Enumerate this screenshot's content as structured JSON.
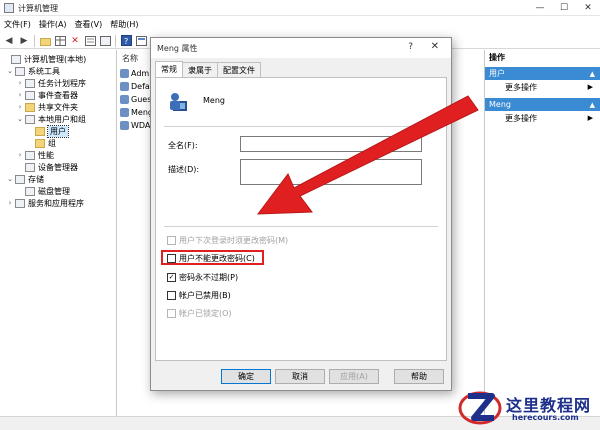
{
  "window": {
    "title": "计算机管理"
  },
  "window_controls": {
    "minimize": "—",
    "maximize": "☐",
    "close": "✕"
  },
  "menu": [
    "文件(F)",
    "操作(A)",
    "查看(V)",
    "帮助(H)"
  ],
  "tree": {
    "root": "计算机管理(本地)",
    "items": [
      {
        "label": "系统工具"
      },
      {
        "label": "任务计划程序"
      },
      {
        "label": "事件查看器"
      },
      {
        "label": "共享文件夹"
      },
      {
        "label": "本地用户和组"
      },
      {
        "label": "用户"
      },
      {
        "label": "组"
      },
      {
        "label": "性能"
      },
      {
        "label": "设备管理器"
      },
      {
        "label": "存储"
      },
      {
        "label": "磁盘管理"
      },
      {
        "label": "服务和应用程序"
      }
    ]
  },
  "list": {
    "header": "名称",
    "rows": [
      "Admi",
      "Defa",
      "Gues",
      "Meng",
      "WDA"
    ]
  },
  "actions": {
    "title": "操作",
    "sections": [
      {
        "label": "用户",
        "more": "更多操作"
      },
      {
        "label": "Meng",
        "more": "更多操作"
      }
    ]
  },
  "dialog": {
    "title": "Meng 属性",
    "help": "?",
    "close": "✕",
    "tabs": [
      "常规",
      "隶属于",
      "配置文件"
    ],
    "user_name": "Meng",
    "fullname_label": "全名(F):",
    "fullname_value": "",
    "desc_label": "描述(D):",
    "desc_value": "",
    "checkboxes": [
      {
        "label": "用户下次登录时须更改密码(M)",
        "checked": false,
        "disabled": true
      },
      {
        "label": "用户不能更改密码(C)",
        "checked": false,
        "disabled": false
      },
      {
        "label": "密码永不过期(P)",
        "checked": true,
        "disabled": false
      },
      {
        "label": "帐户已禁用(B)",
        "checked": false,
        "disabled": false
      },
      {
        "label": "帐户已锁定(O)",
        "checked": false,
        "disabled": true
      }
    ],
    "buttons": {
      "ok": "确定",
      "cancel": "取消",
      "apply": "应用(A)",
      "help": "帮助"
    }
  },
  "watermark": {
    "name": "这里教程网",
    "url": "herecours.com"
  },
  "colors": {
    "accent": "#3b8ad4",
    "arrow": "#e02020",
    "selection": "#cce8ff"
  }
}
